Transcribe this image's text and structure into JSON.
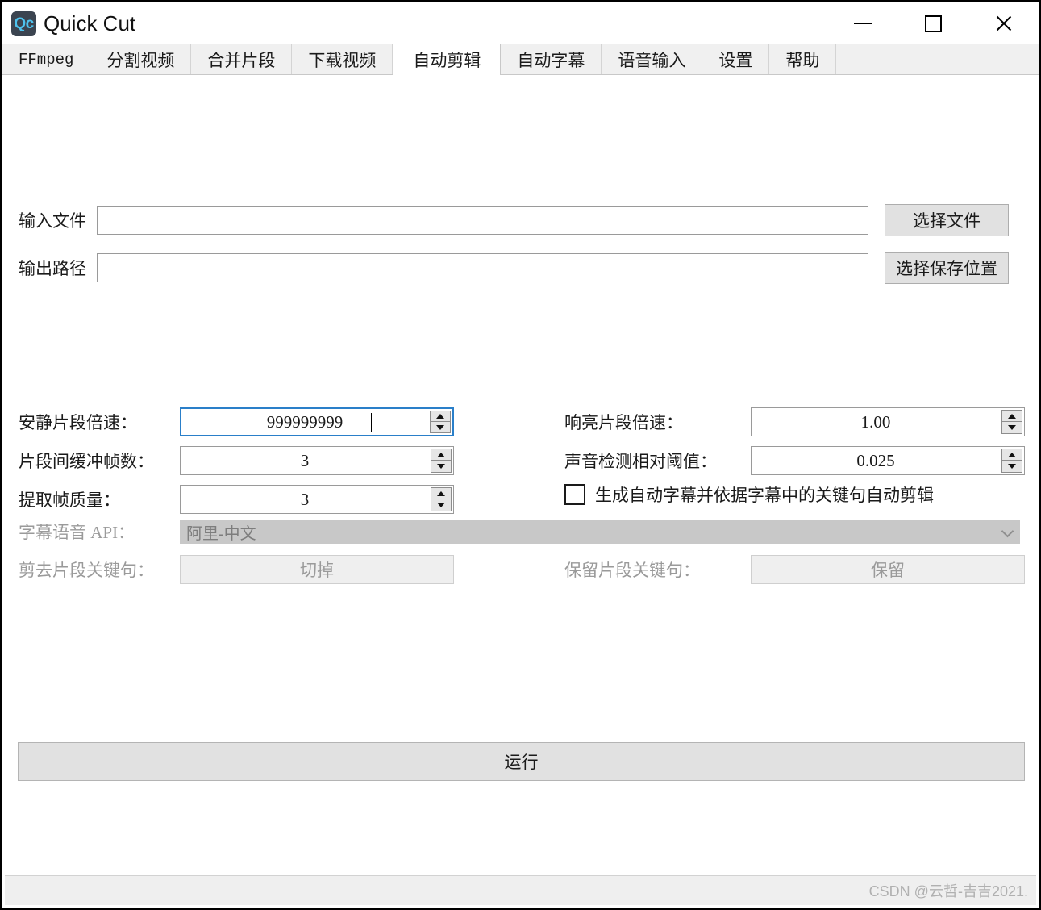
{
  "window": {
    "title": "Quick Cut",
    "icon_label": "Qc",
    "icon_bg": "#3b4450",
    "icon_fg": "#4ec3ee",
    "controls": {
      "minimize": "minimize-icon",
      "maximize": "maximize-icon",
      "close": "close-icon"
    }
  },
  "tabs": [
    {
      "label": "FFmpeg",
      "active": false
    },
    {
      "label": "分割视频",
      "active": false
    },
    {
      "label": "合并片段",
      "active": false
    },
    {
      "label": "下载视频",
      "active": false
    },
    {
      "label": "自动剪辑",
      "active": true
    },
    {
      "label": "自动字幕",
      "active": false
    },
    {
      "label": "语音输入",
      "active": false
    },
    {
      "label": "设置",
      "active": false
    },
    {
      "label": "帮助",
      "active": false
    }
  ],
  "form": {
    "input_file": {
      "label": "输入文件",
      "value": "",
      "placeholder": "",
      "button": "选择文件"
    },
    "output_path": {
      "label": "输出路径",
      "value": "",
      "placeholder": "",
      "button": "选择保存位置"
    },
    "silent_speed": {
      "label": "安静片段倍速：",
      "value": "999999999",
      "focused": true
    },
    "loud_speed": {
      "label": "响亮片段倍速：",
      "value": "1.00",
      "focused": false
    },
    "buffer_frames": {
      "label": "片段间缓冲帧数：",
      "value": "3",
      "focused": false
    },
    "sound_threshold": {
      "label": "声音检测相对阈值：",
      "value": "0.025",
      "focused": false
    },
    "frame_quality": {
      "label": "提取帧质量：",
      "value": "3",
      "focused": false
    },
    "auto_subtitle_checkbox": {
      "label": "生成自动字幕并依据字幕中的关键句自动剪辑",
      "checked": false
    },
    "subtitle_api": {
      "label": "字幕语音 API：",
      "value": "阿里-中文",
      "disabled": true
    },
    "cut_keywords": {
      "label": "剪去片段关键句：",
      "value": "",
      "placeholder": "切掉",
      "disabled": true
    },
    "keep_keywords": {
      "label": "保留片段关键句：",
      "value": "",
      "placeholder": "保留",
      "disabled": true
    },
    "run_button": "运行"
  },
  "statusbar": {
    "watermark": "CSDN @云哲-吉吉2021."
  }
}
